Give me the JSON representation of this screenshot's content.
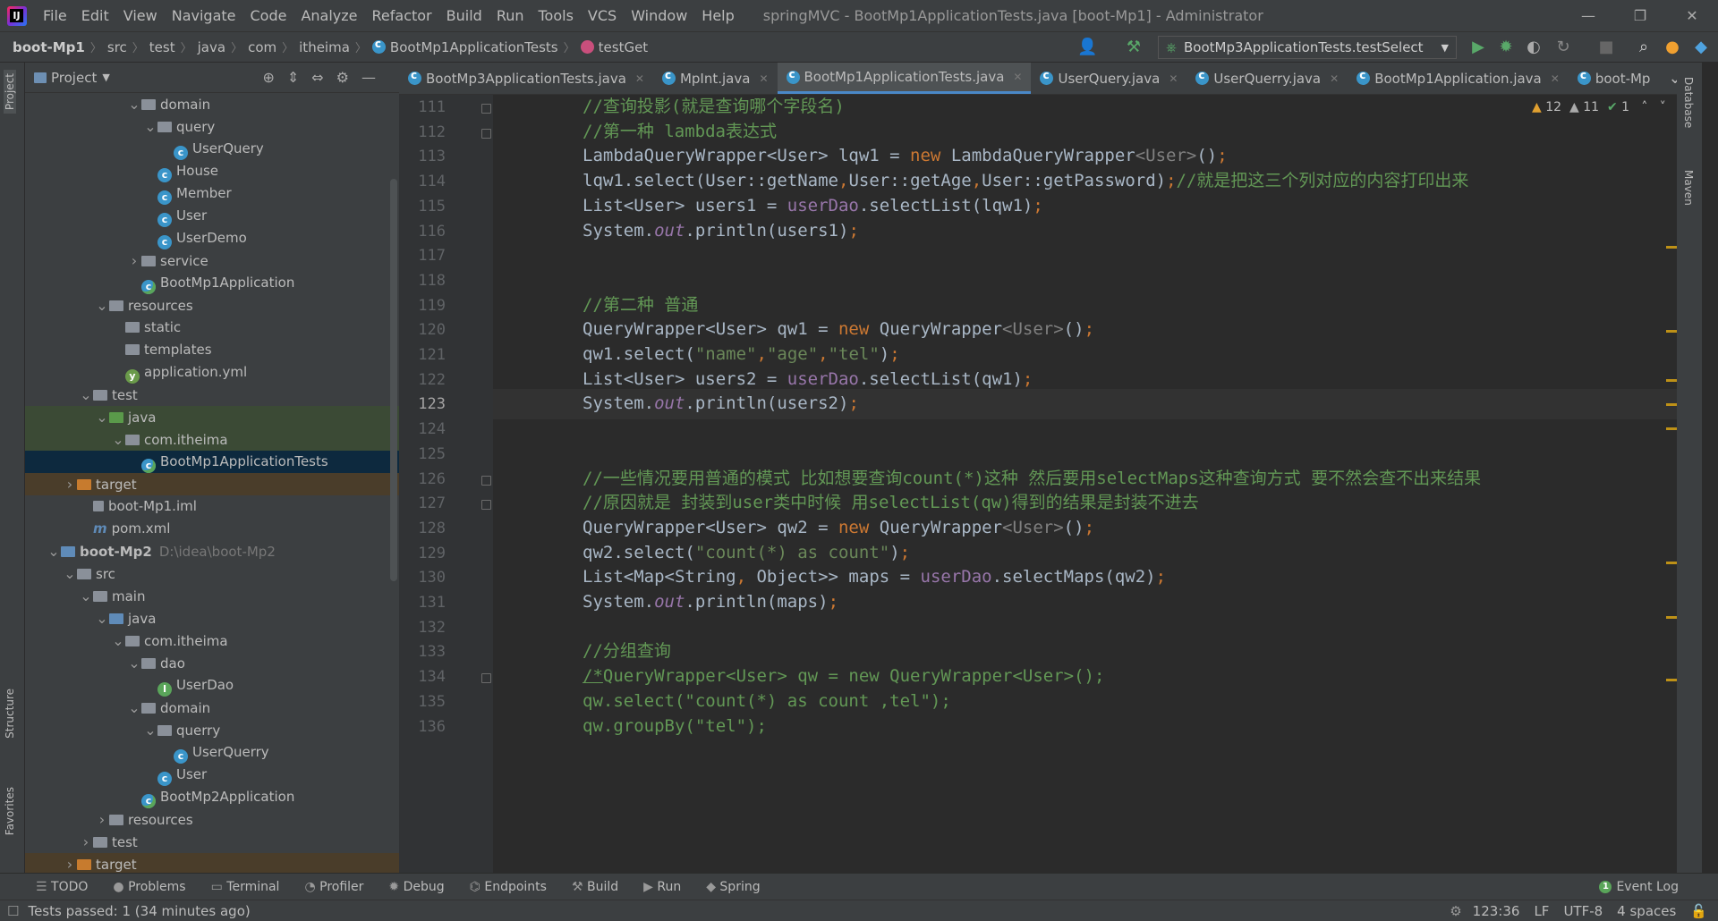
{
  "window": {
    "title": "springMVC - BootMp1ApplicationTests.java [boot-Mp1] - Administrator",
    "controls": [
      "—",
      "❐",
      "✕"
    ]
  },
  "menu": [
    "File",
    "Edit",
    "View",
    "Navigate",
    "Code",
    "Analyze",
    "Refactor",
    "Build",
    "Run",
    "Tools",
    "VCS",
    "Window",
    "Help"
  ],
  "breadcrumb": [
    "boot-Mp1",
    "src",
    "test",
    "java",
    "com",
    "itheima",
    "BootMp1ApplicationTests",
    "testGet"
  ],
  "run_config": "BootMp3ApplicationTests.testSelect",
  "project": {
    "title": "Project",
    "tree": [
      {
        "label": "domain",
        "indent": 4,
        "icon": "folder",
        "arrow": "v"
      },
      {
        "label": "query",
        "indent": 5,
        "icon": "folder",
        "arrow": "v"
      },
      {
        "label": "UserQuery",
        "indent": 6,
        "icon": "class"
      },
      {
        "label": "House",
        "indent": 5,
        "icon": "class"
      },
      {
        "label": "Member",
        "indent": 5,
        "icon": "class"
      },
      {
        "label": "User",
        "indent": 5,
        "icon": "class"
      },
      {
        "label": "UserDemo",
        "indent": 5,
        "icon": "class"
      },
      {
        "label": "service",
        "indent": 4,
        "icon": "folder",
        "arrow": ">"
      },
      {
        "label": "BootMp1Application",
        "indent": 4,
        "icon": "app"
      },
      {
        "label": "resources",
        "indent": 2,
        "icon": "folder",
        "arrow": "v"
      },
      {
        "label": "static",
        "indent": 3,
        "icon": "folder"
      },
      {
        "label": "templates",
        "indent": 3,
        "icon": "folder"
      },
      {
        "label": "application.yml",
        "indent": 3,
        "icon": "yml"
      },
      {
        "label": "test",
        "indent": 1,
        "icon": "folder",
        "arrow": "v"
      },
      {
        "label": "java",
        "indent": 2,
        "icon": "folder-green",
        "arrow": "v",
        "style": "hl"
      },
      {
        "label": "com.itheima",
        "indent": 3,
        "icon": "folder",
        "arrow": "v",
        "style": "hl"
      },
      {
        "label": "BootMp1ApplicationTests",
        "indent": 4,
        "icon": "app",
        "style": "sel"
      },
      {
        "label": "target",
        "indent": 0,
        "icon": "folder-orange",
        "arrow": ">",
        "style": "orange"
      },
      {
        "label": "boot-Mp1.iml",
        "indent": 1,
        "icon": "iml"
      },
      {
        "label": "pom.xml",
        "indent": 1,
        "icon": "maven"
      },
      {
        "label": "boot-Mp2",
        "indent": -1,
        "icon": "module",
        "arrow": "v",
        "extra": "D:\\idea\\boot-Mp2",
        "bold": true
      },
      {
        "label": "src",
        "indent": 0,
        "icon": "folder",
        "arrow": "v"
      },
      {
        "label": "main",
        "indent": 1,
        "icon": "folder",
        "arrow": "v"
      },
      {
        "label": "java",
        "indent": 2,
        "icon": "folder-blue",
        "arrow": "v"
      },
      {
        "label": "com.itheima",
        "indent": 3,
        "icon": "folder",
        "arrow": "v"
      },
      {
        "label": "dao",
        "indent": 4,
        "icon": "folder",
        "arrow": "v"
      },
      {
        "label": "UserDao",
        "indent": 5,
        "icon": "interface"
      },
      {
        "label": "domain",
        "indent": 4,
        "icon": "folder",
        "arrow": "v"
      },
      {
        "label": "querry",
        "indent": 5,
        "icon": "folder",
        "arrow": "v"
      },
      {
        "label": "UserQuerry",
        "indent": 6,
        "icon": "class"
      },
      {
        "label": "User",
        "indent": 5,
        "icon": "class"
      },
      {
        "label": "BootMp2Application",
        "indent": 4,
        "icon": "app"
      },
      {
        "label": "resources",
        "indent": 2,
        "icon": "folder",
        "arrow": ">"
      },
      {
        "label": "test",
        "indent": 1,
        "icon": "folder",
        "arrow": ">"
      },
      {
        "label": "target",
        "indent": 0,
        "icon": "folder-orange",
        "arrow": ">",
        "style": "orange"
      }
    ]
  },
  "tabs": [
    {
      "label": "BootMp3ApplicationTests.java",
      "active": false
    },
    {
      "label": "MpInt.java",
      "active": false
    },
    {
      "label": "BootMp1ApplicationTests.java",
      "active": true
    },
    {
      "label": "UserQuery.java",
      "active": false
    },
    {
      "label": "UserQuerry.java",
      "active": false
    },
    {
      "label": "BootMp1Application.java",
      "active": false
    },
    {
      "label": "boot-Mp",
      "active": false
    }
  ],
  "inspections": {
    "warnings": "12",
    "weak_warnings": "11",
    "ok": "1"
  },
  "editor": {
    "current_line": 123,
    "lines": [
      {
        "n": 111,
        "fold": true,
        "html": "<span class=\"cm\">//查询投影(就是查询哪个字段名)</span>"
      },
      {
        "n": 112,
        "fold": true,
        "html": "<span class=\"cm\">//第一种 lambda表达式</span>"
      },
      {
        "n": 113,
        "html": "LambdaQueryWrapper&lt;User&gt; lqw1 = <span class=\"kw\">new</span> LambdaQueryWrapper<span class=\"ty\">&lt;User&gt;</span>()<span class=\"kw\">;</span>"
      },
      {
        "n": 114,
        "html": "lqw1.select(User::getName<span class=\"kw\">,</span>User::getAge<span class=\"kw\">,</span>User::getPassword)<span class=\"kw\">;</span><span class=\"cm\">//就是把这三个列对应的内容打印出来</span>"
      },
      {
        "n": 115,
        "html": "List&lt;User&gt; users1 = <span class=\"fld\">userDao</span>.selectList(lqw1)<span class=\"kw\">;</span>"
      },
      {
        "n": 116,
        "html": "System.<span class=\"it\">out</span>.println(users1)<span class=\"kw\">;</span>"
      },
      {
        "n": 117,
        "html": ""
      },
      {
        "n": 118,
        "html": ""
      },
      {
        "n": 119,
        "html": "<span class=\"cm\">//第二种 普通</span>"
      },
      {
        "n": 120,
        "html": "QueryWrapper&lt;User&gt; qw1 = <span class=\"kw\">new</span> QueryWrapper<span class=\"ty\">&lt;User&gt;</span>()<span class=\"kw\">;</span>"
      },
      {
        "n": 121,
        "html": "qw1.select(<span class=\"st\">\"name\"</span><span class=\"kw\">,</span><span class=\"st\">\"age\"</span><span class=\"kw\">,</span><span class=\"st\">\"tel\"</span>)<span class=\"kw\">;</span>"
      },
      {
        "n": 122,
        "html": "List&lt;User&gt; users2 = <span class=\"fld\">userDao</span>.selectList(qw1)<span class=\"kw\">;</span>"
      },
      {
        "n": 123,
        "html": "System.<span class=\"it\">out</span>.println(users2)<span class=\"kw\">;</span>"
      },
      {
        "n": 124,
        "html": ""
      },
      {
        "n": 125,
        "html": ""
      },
      {
        "n": 126,
        "fold": true,
        "html": "<span class=\"cm\">//一些情况要用普通的模式 比如想要查询count(*)这种 然后要用selectMaps这种查询方式 要不然会查不出来结果</span>"
      },
      {
        "n": 127,
        "fold": true,
        "html": "<span class=\"cm\">//原因就是 封装到user类中时候 用selectList(qw)得到的结果是封装不进去</span>"
      },
      {
        "n": 128,
        "html": "QueryWrapper&lt;User&gt; qw2 = <span class=\"kw\">new</span> QueryWrapper<span class=\"ty\">&lt;User&gt;</span>()<span class=\"kw\">;</span>"
      },
      {
        "n": 129,
        "html": "qw2.select(<span class=\"st\">\"count(*) as count\"</span>)<span class=\"kw\">;</span>"
      },
      {
        "n": 130,
        "html": "List&lt;Map&lt;String<span class=\"kw\">,</span> Object&gt;&gt; maps = <span class=\"fld\">userDao</span>.selectMaps(qw2)<span class=\"kw\">;</span>"
      },
      {
        "n": 131,
        "html": "System.<span class=\"it\">out</span>.println(maps)<span class=\"kw\">;</span>"
      },
      {
        "n": 132,
        "html": ""
      },
      {
        "n": 133,
        "html": "<span class=\"cm\">//分组查询</span>"
      },
      {
        "n": 134,
        "fold": true,
        "html": "<span class=\"cm\"><u>/*</u>QueryWrapper&lt;User&gt; qw = new QueryWrapper&lt;User&gt;();</span>"
      },
      {
        "n": 135,
        "html": "<span class=\"cm\">qw.select(\"count(*) as count ,tel\");</span>"
      },
      {
        "n": 136,
        "html": "<span class=\"cm\">qw.groupBy(\"tel\");</span>"
      }
    ]
  },
  "toolwindows": [
    "TODO",
    "Problems",
    "Terminal",
    "Profiler",
    "Debug",
    "Endpoints",
    "Build",
    "Run",
    "Spring"
  ],
  "event_log": "Event Log",
  "status": {
    "message": "Tests passed: 1 (34 minutes ago)",
    "position": "123:36",
    "line_sep": "LF",
    "encoding": "UTF-8",
    "indent": "4 spaces"
  },
  "side_labels": {
    "project": "Project",
    "structure": "Structure",
    "favorites": "Favorites",
    "database": "Database",
    "maven": "Maven"
  }
}
